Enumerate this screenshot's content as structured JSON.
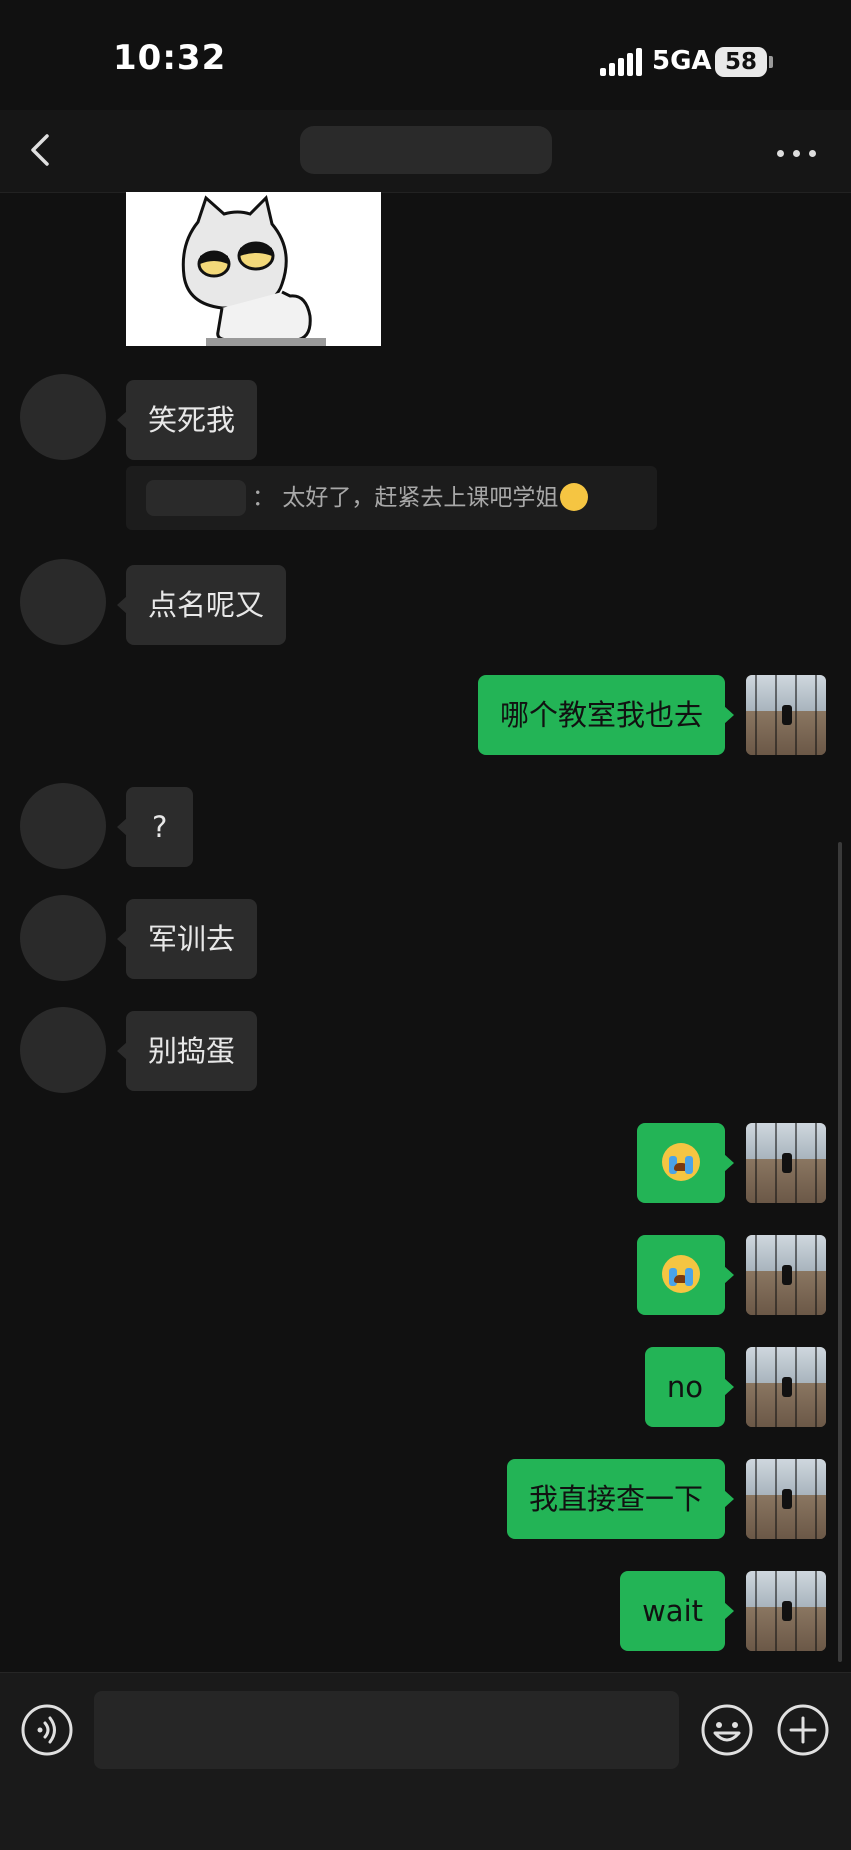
{
  "status_bar": {
    "time": "10:32",
    "network": "5GA",
    "battery": "58"
  },
  "nav": {
    "title": "",
    "icons": [
      "chevron-left-icon",
      "more-dots-icon"
    ]
  },
  "quote": {
    "sender": "",
    "separator": "：",
    "text": "太好了，赶紧去上课吧学姐"
  },
  "messages": [
    {
      "side": "in",
      "text": "笑死我"
    },
    {
      "side": "in",
      "text": "点名呢又"
    },
    {
      "side": "out",
      "text": "哪个教室我也去"
    },
    {
      "side": "in",
      "text": "?"
    },
    {
      "side": "in",
      "text": "军训去"
    },
    {
      "side": "in",
      "text": "别捣蛋"
    },
    {
      "side": "out",
      "emoji": "loudly-crying-face"
    },
    {
      "side": "out",
      "emoji": "loudly-crying-face"
    },
    {
      "side": "out",
      "text": "no"
    },
    {
      "side": "out",
      "text": "我直接查一下"
    },
    {
      "side": "out",
      "text": "wait"
    }
  ],
  "input": {
    "value": "",
    "placeholder": ""
  },
  "colors": {
    "background": "#111111",
    "incoming_bubble": "#2c2c2c",
    "outgoing_bubble": "#23b456"
  }
}
